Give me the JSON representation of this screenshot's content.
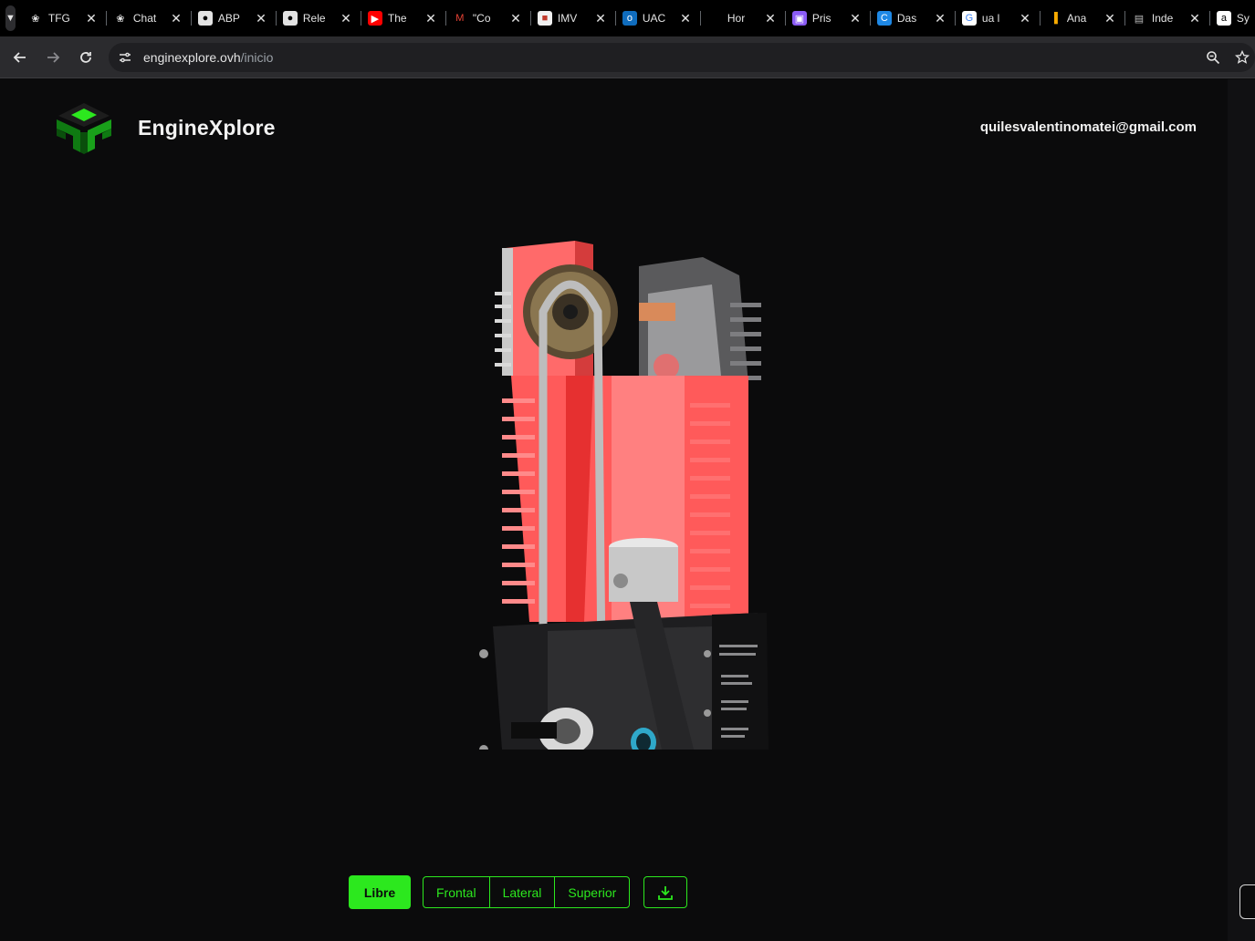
{
  "browser": {
    "tabs": [
      {
        "title": "TFG",
        "icon": "openai-icon"
      },
      {
        "title": "Chat",
        "icon": "openai-icon"
      },
      {
        "title": "ABP",
        "icon": "github-icon"
      },
      {
        "title": "Rele",
        "icon": "github-icon"
      },
      {
        "title": "The",
        "icon": "youtube-icon"
      },
      {
        "title": "\"Co",
        "icon": "gmail-icon"
      },
      {
        "title": "IMV",
        "icon": "imv-icon"
      },
      {
        "title": "UAC",
        "icon": "outlook-icon"
      },
      {
        "title": "Hor",
        "icon": "blank-icon"
      },
      {
        "title": "Pris",
        "icon": "prisma-icon"
      },
      {
        "title": "Das",
        "icon": "dashboard-icon"
      },
      {
        "title": "ua l",
        "icon": "google-icon"
      },
      {
        "title": "Ana",
        "icon": "analytics-icon"
      },
      {
        "title": "Inde",
        "icon": "index-icon"
      },
      {
        "title": "Sy",
        "icon": "amazon-icon"
      }
    ],
    "url_host": "enginexplore.ovh",
    "url_path": "/inicio"
  },
  "header": {
    "brand": "EngineXplore",
    "user_email": "quilesvalentinomatei@gmail.com"
  },
  "controls": {
    "mode_button": "Libre",
    "views": [
      "Frontal",
      "Lateral",
      "Superior"
    ],
    "download_icon": "download-icon"
  },
  "colors": {
    "accent": "#2ce81e",
    "background": "#0b0b0c",
    "engine_red": "#ff5a5a"
  }
}
